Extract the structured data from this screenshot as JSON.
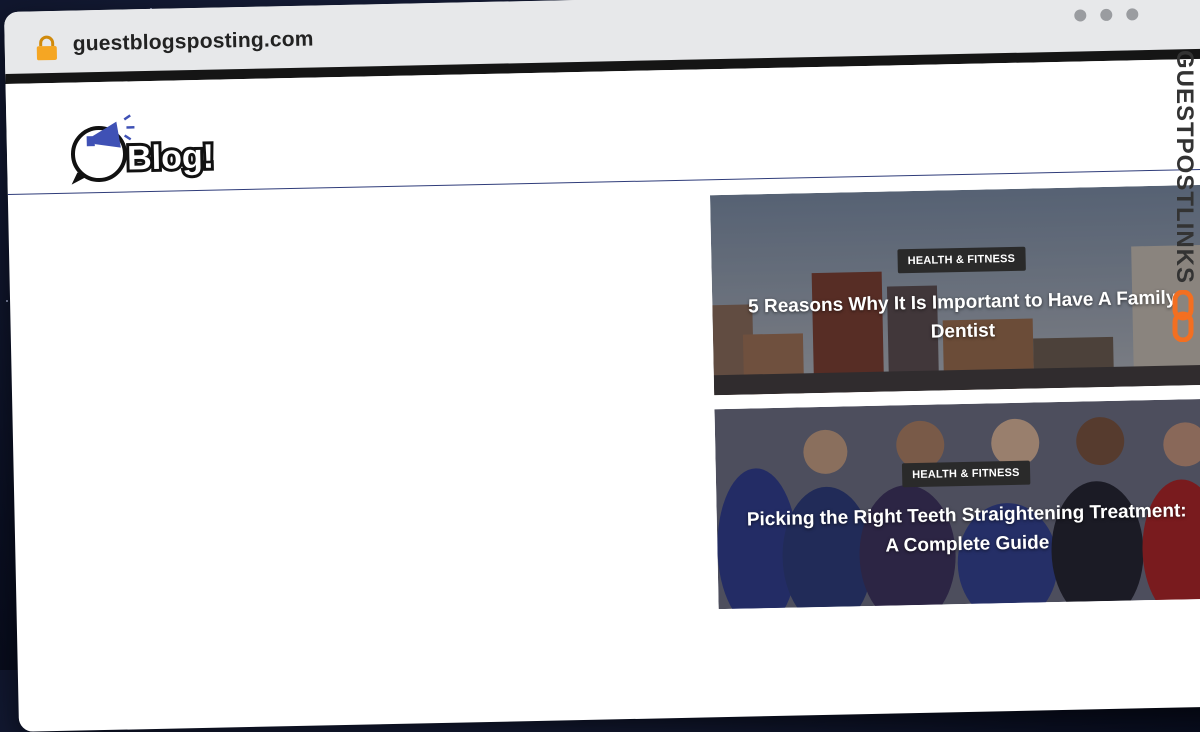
{
  "browser": {
    "url": "guestblogsposting.com"
  },
  "site": {
    "logo_text": "Blog!",
    "side_brand": "GUESTPOSTLINKS"
  },
  "posts": [
    {
      "category": "HEALTH & FITNESS",
      "title": "5 Reasons Why It Is Important to Have A Family Dentist"
    },
    {
      "category": "HEALTH & FITNESS",
      "title": "Picking the Right Teeth Straightening Treatment: A Complete Guide"
    }
  ],
  "colors": {
    "accent_blue": "#3f51b5",
    "brand_orange": "#f36f21",
    "header_rule": "#2f3c7a"
  },
  "icons": [
    "lock-icon",
    "megaphone-icon",
    "chain-link-icon"
  ]
}
